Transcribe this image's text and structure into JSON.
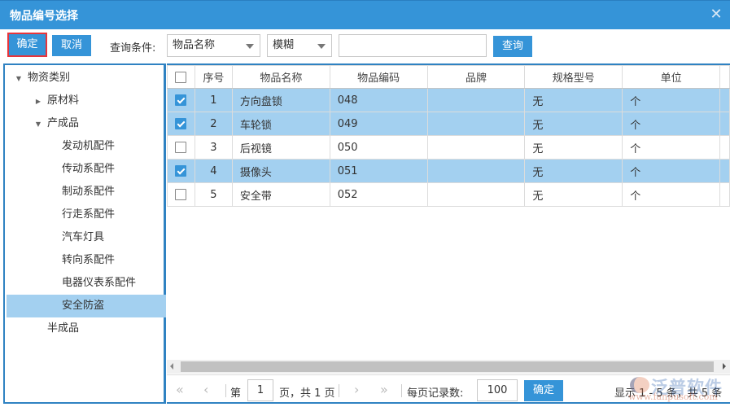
{
  "dialog": {
    "title": "物品编号选择",
    "close_icon": "close-icon"
  },
  "toolbar": {
    "ok_label": "确定",
    "cancel_label": "取消",
    "condition_label": "查询条件:",
    "field_select_value": "物品名称",
    "mode_select_value": "模糊",
    "search_value": "",
    "query_label": "查询"
  },
  "tree": {
    "items": [
      {
        "label": "物资类别",
        "level": 0,
        "toggle": "expanded",
        "selected": false
      },
      {
        "label": "原材料",
        "level": 1,
        "toggle": "collapsed",
        "selected": false
      },
      {
        "label": "产成品",
        "level": 1,
        "toggle": "expanded",
        "selected": false
      },
      {
        "label": "发动机配件",
        "level": 2,
        "toggle": "none",
        "selected": false
      },
      {
        "label": "传动系配件",
        "level": 2,
        "toggle": "none",
        "selected": false
      },
      {
        "label": "制动系配件",
        "level": 2,
        "toggle": "none",
        "selected": false
      },
      {
        "label": "行走系配件",
        "level": 2,
        "toggle": "none",
        "selected": false
      },
      {
        "label": "汽车灯具",
        "level": 2,
        "toggle": "none",
        "selected": false
      },
      {
        "label": "转向系配件",
        "level": 2,
        "toggle": "none",
        "selected": false
      },
      {
        "label": "电器仪表系配件",
        "level": 2,
        "toggle": "none",
        "selected": false
      },
      {
        "label": "安全防盗",
        "level": 2,
        "toggle": "none",
        "selected": true
      },
      {
        "label": "半成品",
        "level": 1,
        "toggle": "none",
        "selected": false
      }
    ]
  },
  "grid": {
    "columns": [
      "序号",
      "物品名称",
      "物品编码",
      "品牌",
      "规格型号",
      "单位"
    ],
    "rows": [
      {
        "checked": true,
        "index": "1",
        "name": "方向盘锁",
        "code": "048",
        "brand": "",
        "spec": "无",
        "unit": "个"
      },
      {
        "checked": true,
        "index": "2",
        "name": "车轮锁",
        "code": "049",
        "brand": "",
        "spec": "无",
        "unit": "个"
      },
      {
        "checked": false,
        "index": "3",
        "name": "后视镜",
        "code": "050",
        "brand": "",
        "spec": "无",
        "unit": "个"
      },
      {
        "checked": true,
        "index": "4",
        "name": "摄像头",
        "code": "051",
        "brand": "",
        "spec": "无",
        "unit": "个"
      },
      {
        "checked": false,
        "index": "5",
        "name": "安全带",
        "code": "052",
        "brand": "",
        "spec": "无",
        "unit": "个"
      }
    ]
  },
  "pager": {
    "first": "«",
    "prev": "‹",
    "page_prefix": "第",
    "page_value": "1",
    "page_suffix": "页，共 1 页",
    "next": "›",
    "last": "»",
    "page_size_label": "每页记录数:",
    "page_size_value": "100",
    "go_label": "确定",
    "summary": "显示 1 - 5 条，共 5 条"
  },
  "watermark": {
    "brand": "泛普软件",
    "url": "www.fanpusoft.com"
  },
  "colors": {
    "accent": "#3594d8",
    "selected_row": "#a3d0f0",
    "highlight_border": "#e8353b"
  }
}
